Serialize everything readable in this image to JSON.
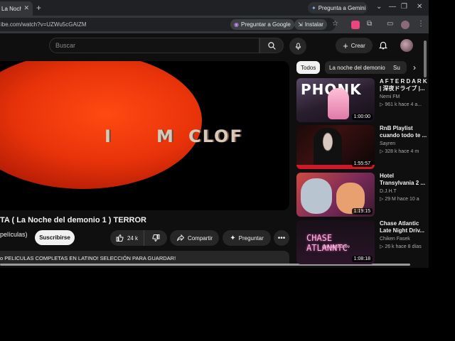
{
  "browser": {
    "tab_title": "La Noch",
    "gemini_label": "Pregunta a Gemini",
    "url": "ibe.com/watch?v=UZWu5cGAIZM",
    "google_pill": "Preguntar a Google",
    "install_pill": "Instalar"
  },
  "yt": {
    "search_placeholder": "Buscar",
    "create_label": "Crear"
  },
  "video": {
    "overlay_text_1": "I",
    "overlay_text_2": "M",
    "overlay_text_3": "CLOF",
    "title": "TA ( La Noche del demonio 1 ) TERROR",
    "channel": "películas)",
    "subscribe": "Suscribirse",
    "likes": "24 k",
    "share": "Compartir",
    "ask": "Preguntar",
    "description": "o  PELICULAS COMPLETAS EN LATINO! SELECCIÓN PARA GUARDAR!"
  },
  "chips": [
    {
      "label": "Todos"
    },
    {
      "label": "La noche del demonio"
    },
    {
      "label": "Su"
    }
  ],
  "recommendations": [
    {
      "thumb_text": "PHONK",
      "duration": "1:00:00",
      "title_1": "A F T E R D A R K",
      "title_2": "| 深夜ドライブ |...",
      "channel": "Nemi FM",
      "stats": "▷ 961 k  hace 4 a..."
    },
    {
      "duration": "1:55:57",
      "title_1": "RnB Playlist",
      "title_2": "cuando todo te ...",
      "channel": "Sayren",
      "stats": "▷ 328 k  hace 4 m"
    },
    {
      "duration": "1:19:15",
      "title_1": "Hotel",
      "title_2": "Transylvania 2 ...",
      "channel": "D.J.H.T",
      "stats": "▷ 29 M  hace 10 a"
    },
    {
      "thumb_text": "CHASE ATLANNTC",
      "thumb_sub": "late night drive",
      "duration": "1:08:18",
      "title_1": " Chase Atlantic",
      "title_2": "Late Night Driv...",
      "channel": "Chiken Fasek",
      "stats": "▷ 26 k  hace 8 días"
    }
  ],
  "colors": {
    "accent_red": "#e8330a",
    "background": "#0f0f0f"
  }
}
